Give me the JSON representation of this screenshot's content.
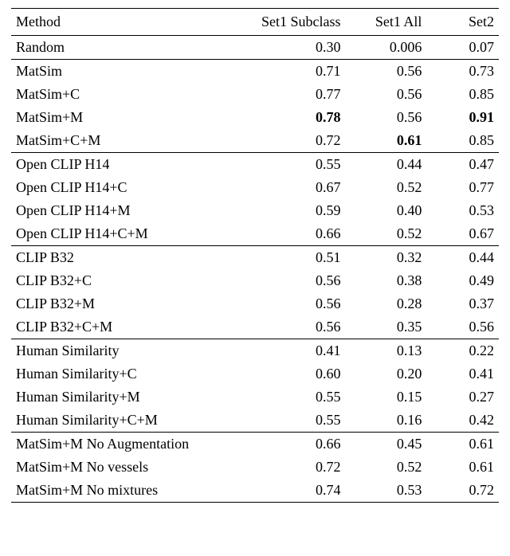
{
  "columns": {
    "method": "Method",
    "c1": "Set1 Subclass",
    "c2": "Set1 All",
    "c3": "Set2"
  },
  "groups": [
    {
      "rows": [
        {
          "method": "Random",
          "c1": "0.30",
          "c2": "0.006",
          "c3": "0.07"
        }
      ]
    },
    {
      "rows": [
        {
          "method": "MatSim",
          "c1": "0.71",
          "c2": "0.56",
          "c3": "0.73"
        },
        {
          "method": "MatSim+C",
          "c1": "0.77",
          "c2": "0.56",
          "c3": "0.85"
        },
        {
          "method": "MatSim+M",
          "c1": "0.78",
          "c2": "0.56",
          "c3": "0.91",
          "bold": [
            "c1",
            "c3"
          ]
        },
        {
          "method": "MatSim+C+M",
          "c1": "0.72",
          "c2": "0.61",
          "c3": "0.85",
          "bold": [
            "c2"
          ]
        }
      ]
    },
    {
      "rows": [
        {
          "method": "Open CLIP H14",
          "c1": "0.55",
          "c2": "0.44",
          "c3": "0.47"
        },
        {
          "method": "Open CLIP H14+C",
          "c1": "0.67",
          "c2": "0.52",
          "c3": "0.77"
        },
        {
          "method": "Open CLIP H14+M",
          "c1": "0.59",
          "c2": "0.40",
          "c3": "0.53"
        },
        {
          "method": "Open CLIP H14+C+M",
          "c1": "0.66",
          "c2": "0.52",
          "c3": "0.67"
        }
      ]
    },
    {
      "rows": [
        {
          "method": "CLIP B32",
          "c1": "0.51",
          "c2": "0.32",
          "c3": "0.44"
        },
        {
          "method": "CLIP B32+C",
          "c1": "0.56",
          "c2": "0.38",
          "c3": "0.49"
        },
        {
          "method": "CLIP B32+M",
          "c1": "0.56",
          "c2": "0.28",
          "c3": "0.37"
        },
        {
          "method": "CLIP B32+C+M",
          "c1": "0.56",
          "c2": "0.35",
          "c3": "0.56"
        }
      ]
    },
    {
      "rows": [
        {
          "method": "Human Similarity",
          "c1": "0.41",
          "c2": "0.13",
          "c3": "0.22"
        },
        {
          "method": "Human Similarity+C",
          "c1": "0.60",
          "c2": "0.20",
          "c3": "0.41"
        },
        {
          "method": "Human Similarity+M",
          "c1": "0.55",
          "c2": "0.15",
          "c3": "0.27"
        },
        {
          "method": "Human Similarity+C+M",
          "c1": "0.55",
          "c2": "0.16",
          "c3": "0.42"
        }
      ]
    },
    {
      "rows": [
        {
          "method": "MatSim+M No Augmentation",
          "c1": "0.66",
          "c2": "0.45",
          "c3": "0.61"
        },
        {
          "method": "MatSim+M No vessels",
          "c1": "0.72",
          "c2": "0.52",
          "c3": "0.61"
        },
        {
          "method": "MatSim+M No mixtures",
          "c1": "0.74",
          "c2": "0.53",
          "c3": "0.72"
        }
      ]
    }
  ],
  "chart_data": {
    "type": "table",
    "title": "",
    "columns": [
      "Method",
      "Set1 Subclass",
      "Set1 All",
      "Set2"
    ],
    "rows": [
      [
        "Random",
        0.3,
        0.006,
        0.07
      ],
      [
        "MatSim",
        0.71,
        0.56,
        0.73
      ],
      [
        "MatSim+C",
        0.77,
        0.56,
        0.85
      ],
      [
        "MatSim+M",
        0.78,
        0.56,
        0.91
      ],
      [
        "MatSim+C+M",
        0.72,
        0.61,
        0.85
      ],
      [
        "Open CLIP H14",
        0.55,
        0.44,
        0.47
      ],
      [
        "Open CLIP H14+C",
        0.67,
        0.52,
        0.77
      ],
      [
        "Open CLIP H14+M",
        0.59,
        0.4,
        0.53
      ],
      [
        "Open CLIP H14+C+M",
        0.66,
        0.52,
        0.67
      ],
      [
        "CLIP B32",
        0.51,
        0.32,
        0.44
      ],
      [
        "CLIP B32+C",
        0.56,
        0.38,
        0.49
      ],
      [
        "CLIP B32+M",
        0.56,
        0.28,
        0.37
      ],
      [
        "CLIP B32+C+M",
        0.56,
        0.35,
        0.56
      ],
      [
        "Human Similarity",
        0.41,
        0.13,
        0.22
      ],
      [
        "Human Similarity+C",
        0.6,
        0.2,
        0.41
      ],
      [
        "Human Similarity+M",
        0.55,
        0.15,
        0.27
      ],
      [
        "Human Similarity+C+M",
        0.55,
        0.16,
        0.42
      ],
      [
        "MatSim+M No Augmentation",
        0.66,
        0.45,
        0.61
      ],
      [
        "MatSim+M No vessels",
        0.72,
        0.52,
        0.61
      ],
      [
        "MatSim+M No mixtures",
        0.74,
        0.53,
        0.72
      ]
    ]
  }
}
